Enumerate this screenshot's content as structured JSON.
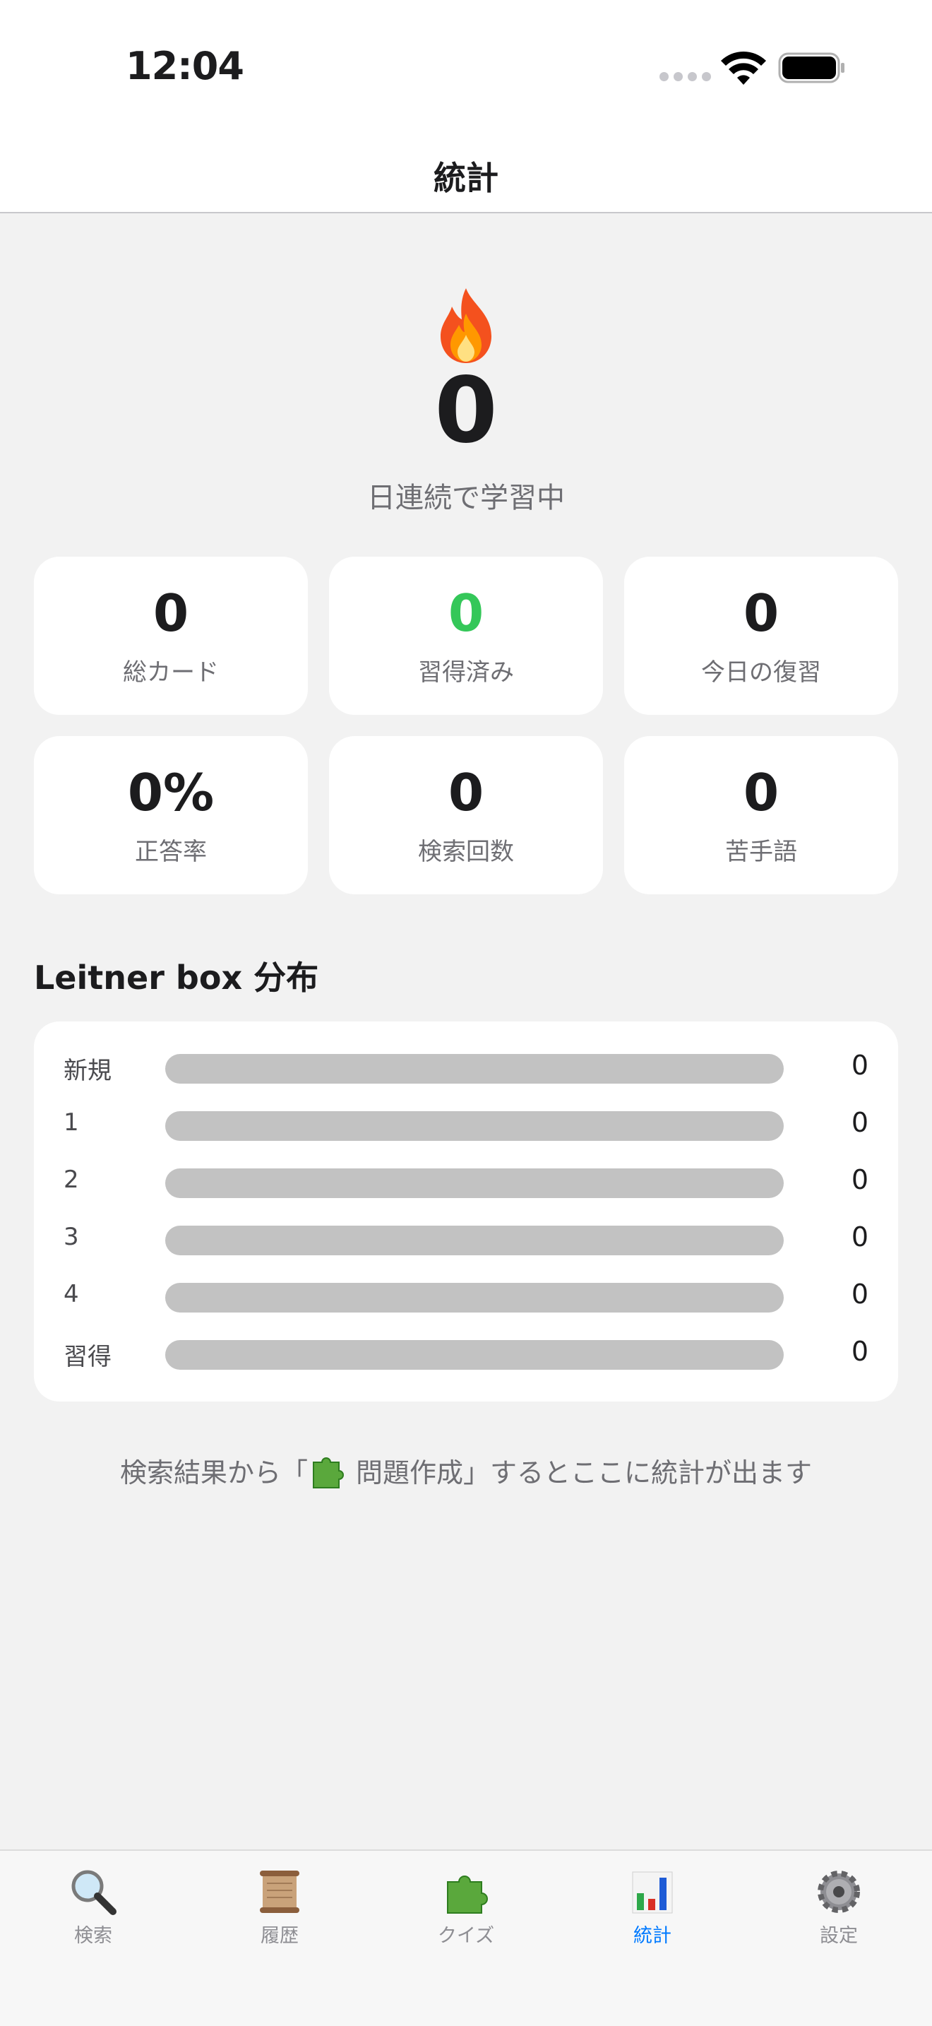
{
  "status_bar": {
    "time": "12:04"
  },
  "nav": {
    "title": "統計"
  },
  "streak": {
    "value": "0",
    "label": "日連続で学習中"
  },
  "stats": [
    {
      "value": "0",
      "label": "総カード",
      "color": "#1c1c1e"
    },
    {
      "value": "0",
      "label": "習得済み",
      "color": "#34c759"
    },
    {
      "value": "0",
      "label": "今日の復習",
      "color": "#1c1c1e"
    },
    {
      "value": "0%",
      "label": "正答率",
      "color": "#1c1c1e"
    },
    {
      "value": "0",
      "label": "検索回数",
      "color": "#1c1c1e"
    },
    {
      "value": "0",
      "label": "苦手語",
      "color": "#1c1c1e"
    }
  ],
  "leitner": {
    "title": "Leitner box 分布",
    "rows": [
      {
        "label": "新規",
        "count": "0",
        "fraction": 0
      },
      {
        "label": "1",
        "count": "0",
        "fraction": 0
      },
      {
        "label": "2",
        "count": "0",
        "fraction": 0
      },
      {
        "label": "3",
        "count": "0",
        "fraction": 0
      },
      {
        "label": "4",
        "count": "0",
        "fraction": 0
      },
      {
        "label": "習得",
        "count": "0",
        "fraction": 0
      }
    ]
  },
  "hint": {
    "before": "検索結果から「",
    "after": " 問題作成」するとここに統計が出ます",
    "icon": "puzzle-icon"
  },
  "tabs": [
    {
      "label": "検索",
      "icon": "magnifier-icon",
      "active": false
    },
    {
      "label": "履歴",
      "icon": "scroll-icon",
      "active": false
    },
    {
      "label": "クイズ",
      "icon": "puzzle-icon",
      "active": false
    },
    {
      "label": "統計",
      "icon": "bar-chart-icon",
      "active": true
    },
    {
      "label": "設定",
      "icon": "gear-icon",
      "active": false
    }
  ],
  "colors": {
    "accent": "#007aff",
    "mastered": "#34c759",
    "background": "#f2f2f2",
    "bar_track": "#c2c2c2"
  }
}
